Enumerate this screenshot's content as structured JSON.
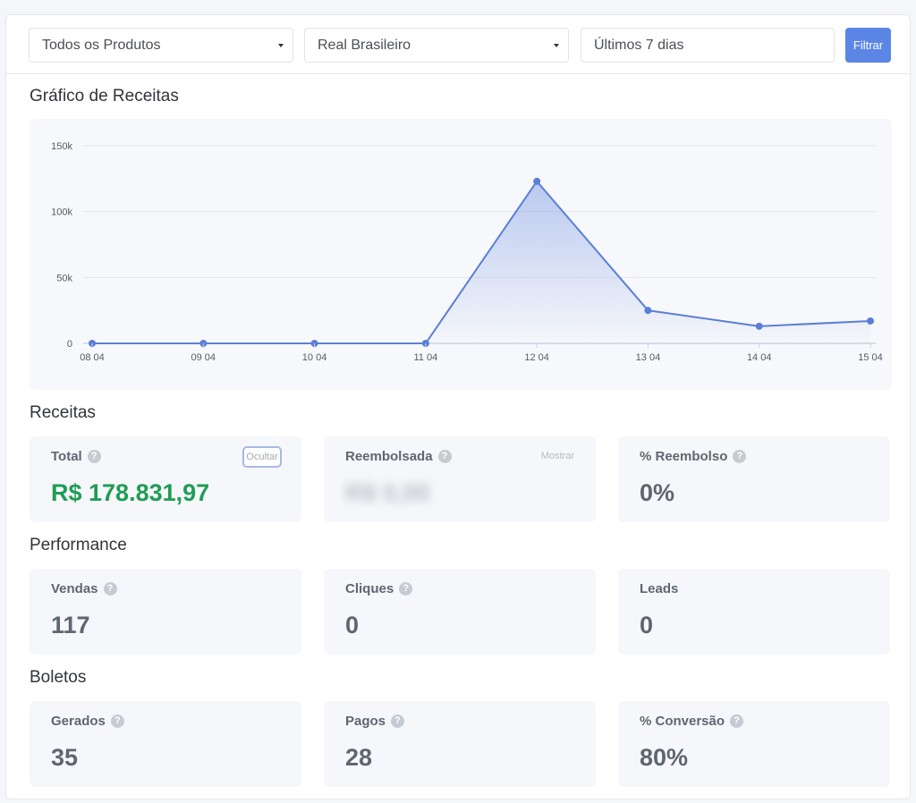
{
  "filters": {
    "product": "Todos os Produtos",
    "currency": "Real Brasileiro",
    "period": "Últimos 7 dias",
    "filter_button": "Filtrar"
  },
  "chart_section": {
    "title": "Gráfico de Receitas"
  },
  "chart_data": {
    "type": "area",
    "categories": [
      "08 04",
      "09 04",
      "10 04",
      "11 04",
      "12 04",
      "13 04",
      "14 04",
      "15 04"
    ],
    "values": [
      0,
      0,
      0,
      0,
      123000,
      25000,
      13000,
      17000
    ],
    "ylim": [
      0,
      150000
    ],
    "yticks": [
      0,
      50000,
      100000,
      150000
    ],
    "ytick_labels": [
      "0",
      "50k",
      "100k",
      "150k"
    ],
    "grid": true,
    "line_color": "#5b7fd6"
  },
  "receitas": {
    "title": "Receitas",
    "total": {
      "label": "Total",
      "value": "R$ 178.831,97",
      "toggle": "Ocultar"
    },
    "reembolsada": {
      "label": "Reembolsada",
      "value": "R$ 0,00",
      "toggle": "Mostrar"
    },
    "reembolso_pct": {
      "label": "% Reembolso",
      "value": "0%"
    }
  },
  "performance": {
    "title": "Performance",
    "vendas": {
      "label": "Vendas",
      "value": "117"
    },
    "cliques": {
      "label": "Cliques",
      "value": "0"
    },
    "leads": {
      "label": "Leads",
      "value": "0"
    }
  },
  "boletos": {
    "title": "Boletos",
    "gerados": {
      "label": "Gerados",
      "value": "35"
    },
    "pagos": {
      "label": "Pagos",
      "value": "28"
    },
    "conversao": {
      "label": "% Conversão",
      "value": "80%"
    }
  },
  "colors": {
    "accent": "#5b86e5",
    "positive": "#1f9d55"
  }
}
